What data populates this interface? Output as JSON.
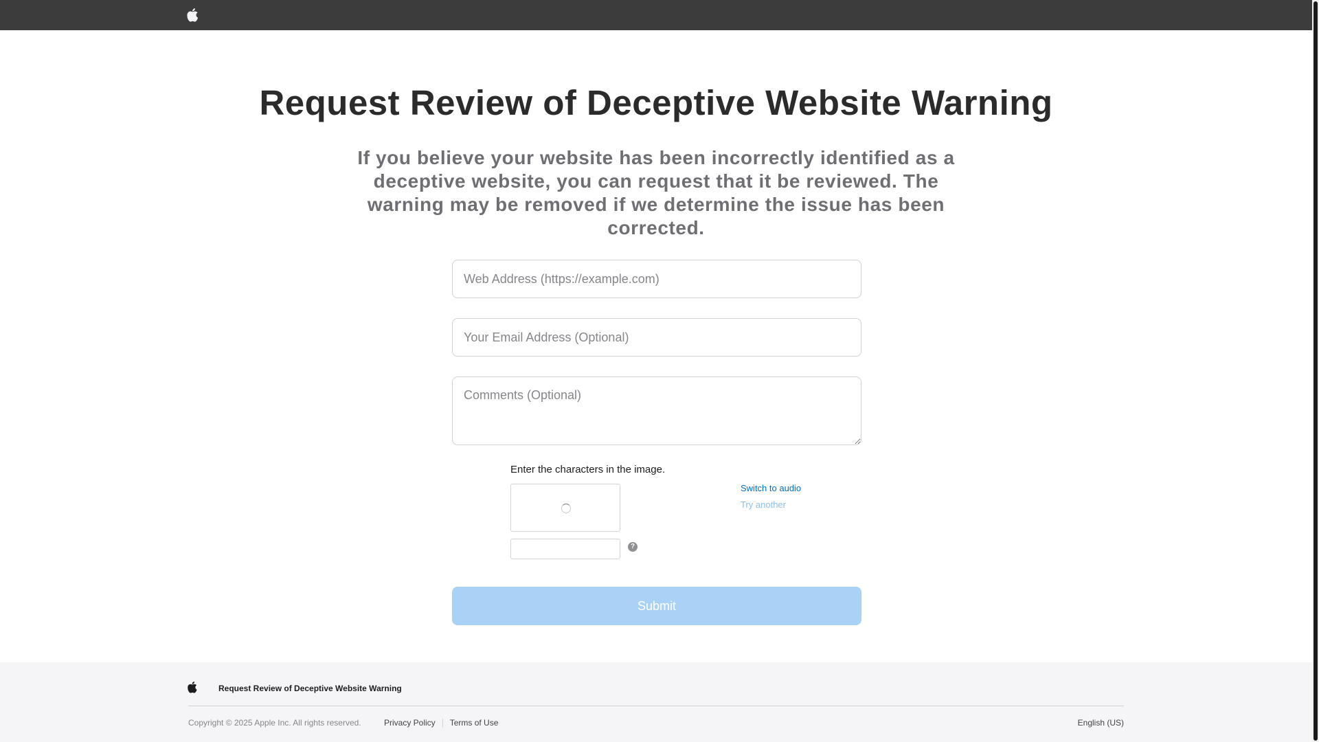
{
  "nav": {
    "logo_icon": "apple-logo-icon",
    "background": "#3c3c3c"
  },
  "main": {
    "title": "Request Review of Deceptive Website Warning",
    "subtitle": "If you believe your website has been incorrectly identified as a deceptive website, you can request that it be reviewed. The warning may be removed if we determine the issue has been corrected.",
    "fields": {
      "url_placeholder": "Web Address (https://example.com)",
      "url_value": "",
      "email_placeholder": "Your Email Address (Optional)",
      "email_value": "",
      "comments_placeholder": "Comments (Optional)",
      "comments_value": ""
    },
    "captcha": {
      "label": "Enter the characters in the image.",
      "input_value": "",
      "help_icon": "question-mark-icon",
      "help_glyph": "?",
      "switch_audio_label": "Switch to audio",
      "try_another_label": "Try another"
    },
    "submit_label": "Submit",
    "submit_color": "#a9d2f6"
  },
  "footer": {
    "logo_icon": "apple-logo-icon",
    "breadcrumb": "Request Review of Deceptive Website Warning",
    "copyright": "Copyright © 2025 Apple Inc. All rights reserved.",
    "links": [
      {
        "label": "Privacy Policy"
      },
      {
        "label": "Terms of Use"
      }
    ],
    "language": "English (US)"
  },
  "colors": {
    "link": "#0070c9",
    "link_disabled": "#8cc0ea",
    "footer_bg": "#f5f5f7"
  }
}
